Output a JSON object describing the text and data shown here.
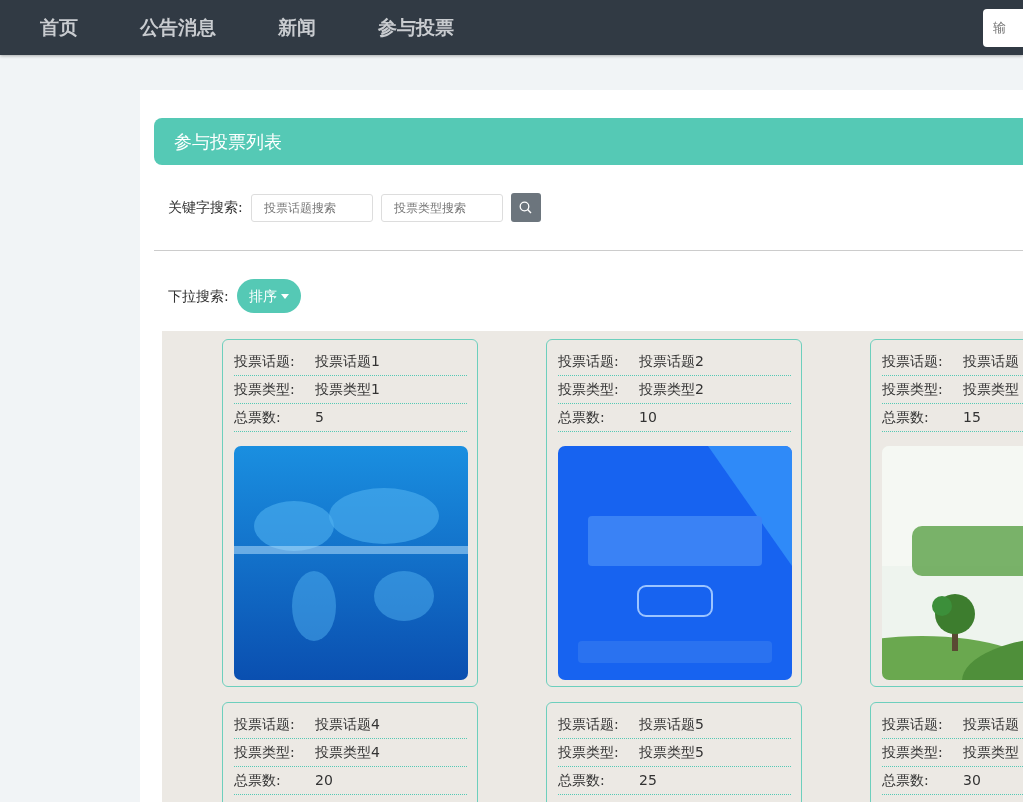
{
  "navbar": {
    "items": [
      {
        "label": "首页"
      },
      {
        "label": "公告消息"
      },
      {
        "label": "新闻"
      },
      {
        "label": "参与投票"
      }
    ],
    "search": {
      "placeholder": "输"
    }
  },
  "panel": {
    "title": "参与投票列表",
    "keyword_search": {
      "label": "关键字搜索:",
      "fields": [
        {
          "placeholder": "投票话题搜索"
        },
        {
          "placeholder": "投票类型搜索"
        }
      ]
    },
    "dropdown_search": {
      "label": "下拉搜索:",
      "button": "排序"
    }
  },
  "cards": [
    {
      "fields": [
        {
          "label": "投票话题:",
          "value": "投票话题1"
        },
        {
          "label": "投票类型:",
          "value": "投票类型1"
        },
        {
          "label": "总票数:",
          "value": "5"
        }
      ],
      "image": {
        "kind": "picture"
      }
    },
    {
      "fields": [
        {
          "label": "投票话题:",
          "value": "投票话题2"
        },
        {
          "label": "投票类型:",
          "value": "投票类型2"
        },
        {
          "label": "总票数:",
          "value": "10"
        }
      ],
      "image": {
        "kind": "picture"
      }
    },
    {
      "fields": [
        {
          "label": "投票话题:",
          "value": "投票话题"
        },
        {
          "label": "投票类型:",
          "value": "投票类型"
        },
        {
          "label": "总票数:",
          "value": "15"
        }
      ],
      "image": {
        "kind": "picture"
      }
    },
    {
      "fields": [
        {
          "label": "投票话题:",
          "value": "投票话题4"
        },
        {
          "label": "投票类型:",
          "value": "投票类型4"
        },
        {
          "label": "总票数:",
          "value": "20"
        }
      ]
    },
    {
      "fields": [
        {
          "label": "投票话题:",
          "value": "投票话题5"
        },
        {
          "label": "投票类型:",
          "value": "投票类型5"
        },
        {
          "label": "总票数:",
          "value": "25"
        }
      ]
    },
    {
      "fields": [
        {
          "label": "投票话题:",
          "value": "投票话题"
        },
        {
          "label": "投票类型:",
          "value": "投票类型"
        },
        {
          "label": "总票数:",
          "value": "30"
        }
      ]
    }
  ]
}
